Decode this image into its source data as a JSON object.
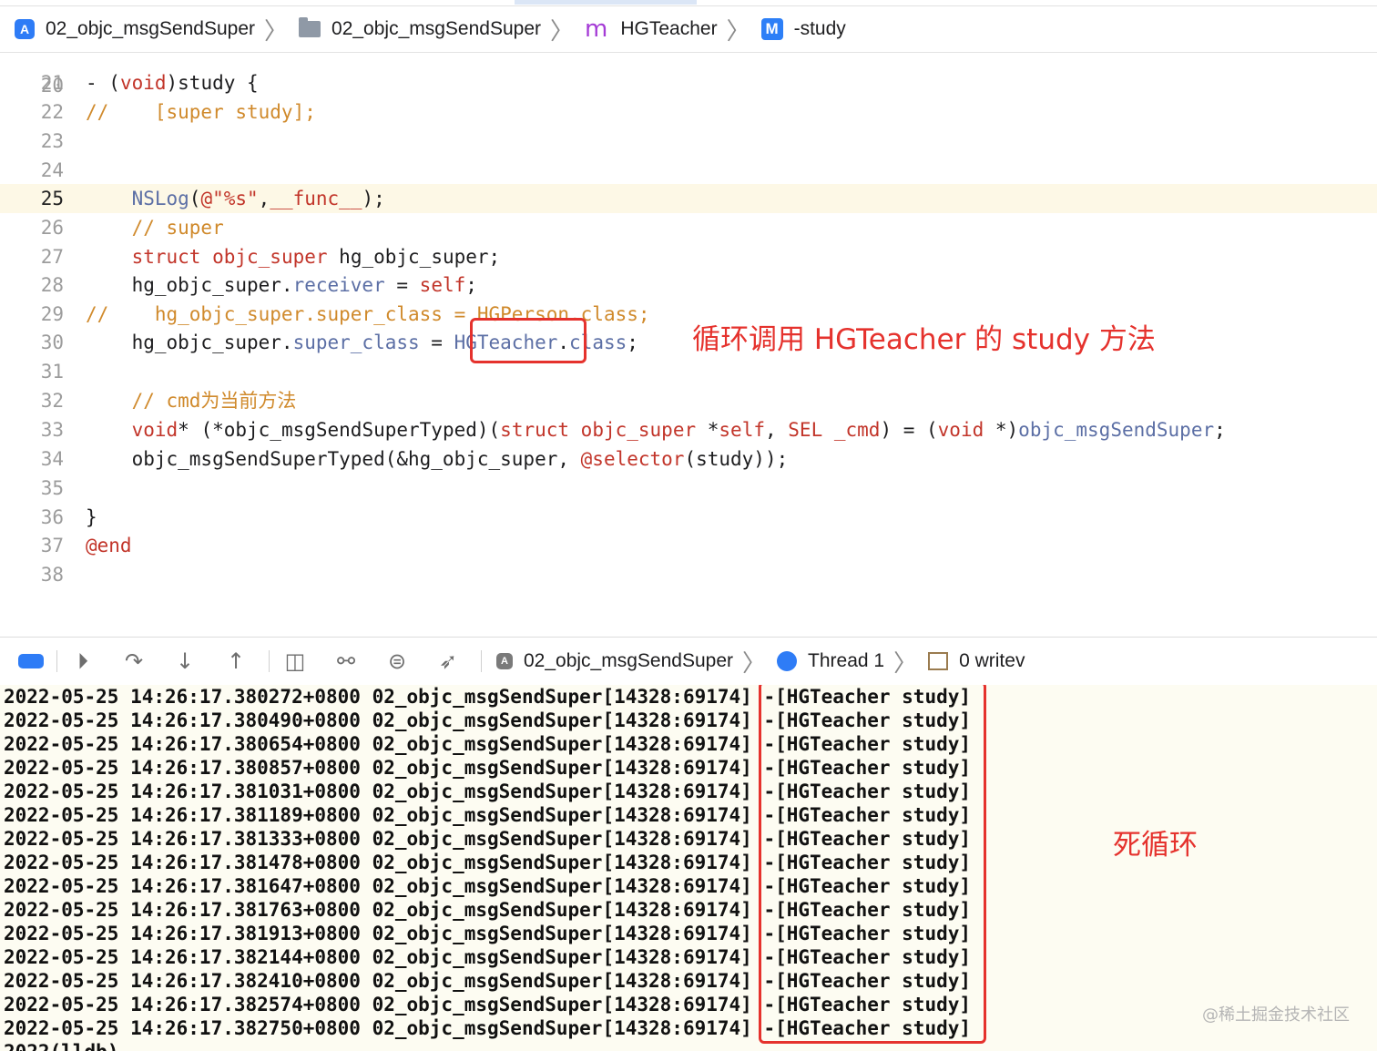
{
  "jumpbar": {
    "items": [
      {
        "label": "02_objc_msgSendSuper",
        "icon": "xcode-app-icon"
      },
      {
        "label": "02_objc_msgSendSuper",
        "icon": "folder-icon"
      },
      {
        "label": "HGTeacher",
        "icon": "m-file-icon"
      },
      {
        "label": "-study",
        "icon": "method-icon"
      }
    ]
  },
  "editor": {
    "first_line_partial": "20",
    "current_line": "25",
    "lines": [
      {
        "n": "21",
        "text": "- (void)study {"
      },
      {
        "n": "22",
        "text": "//    [super study];"
      },
      {
        "n": "23",
        "text": ""
      },
      {
        "n": "24",
        "text": ""
      },
      {
        "n": "25",
        "text": "    NSLog(@\"%s\",__func__);"
      },
      {
        "n": "26",
        "text": "    // super"
      },
      {
        "n": "27",
        "text": "    struct objc_super hg_objc_super;"
      },
      {
        "n": "28",
        "text": "    hg_objc_super.receiver = self;"
      },
      {
        "n": "29",
        "text": "//    hg_objc_super.super_class = HGPerson.class;"
      },
      {
        "n": "30",
        "text": "    hg_objc_super.super_class = HGTeacher.class;"
      },
      {
        "n": "31",
        "text": ""
      },
      {
        "n": "32",
        "text": "    // cmd为当前方法"
      },
      {
        "n": "33",
        "text": "    void* (*objc_msgSendSuperTyped)(struct objc_super *self, SEL _cmd) = (void *)objc_msgSendSuper;"
      },
      {
        "n": "34",
        "text": "    objc_msgSendSuperTyped(&hg_objc_super, @selector(study));"
      },
      {
        "n": "35",
        "text": ""
      },
      {
        "n": "36",
        "text": "}"
      },
      {
        "n": "37",
        "text": "@end"
      },
      {
        "n": "38",
        "text": ""
      }
    ],
    "annotation": "循环调用 HGTeacher 的 study 方法"
  },
  "debugbar": {
    "target": "02_objc_msgSendSuper",
    "thread": "Thread 1",
    "frame": "0 writev"
  },
  "console": {
    "prefix": "2022-05-25 14:26:17.",
    "process": "02_objc_msgSendSuper[14328:69174]",
    "message": "-[HGTeacher study]",
    "timestamps": [
      "380272+0800",
      "380490+0800",
      "380654+0800",
      "380857+0800",
      "381031+0800",
      "381189+0800",
      "381333+0800",
      "381478+0800",
      "381647+0800",
      "381763+0800",
      "381913+0800",
      "382144+0800",
      "382410+0800",
      "382574+0800",
      "382750+0800"
    ],
    "last_partial": "2022(lldb)",
    "annotation": "死循环"
  },
  "watermark": "@稀土掘金技术社区",
  "colors": {
    "accent_red": "#e5322d",
    "keyword": "#c2352a",
    "comment": "#d08a2c",
    "console_bg": "#fdfcf2"
  }
}
